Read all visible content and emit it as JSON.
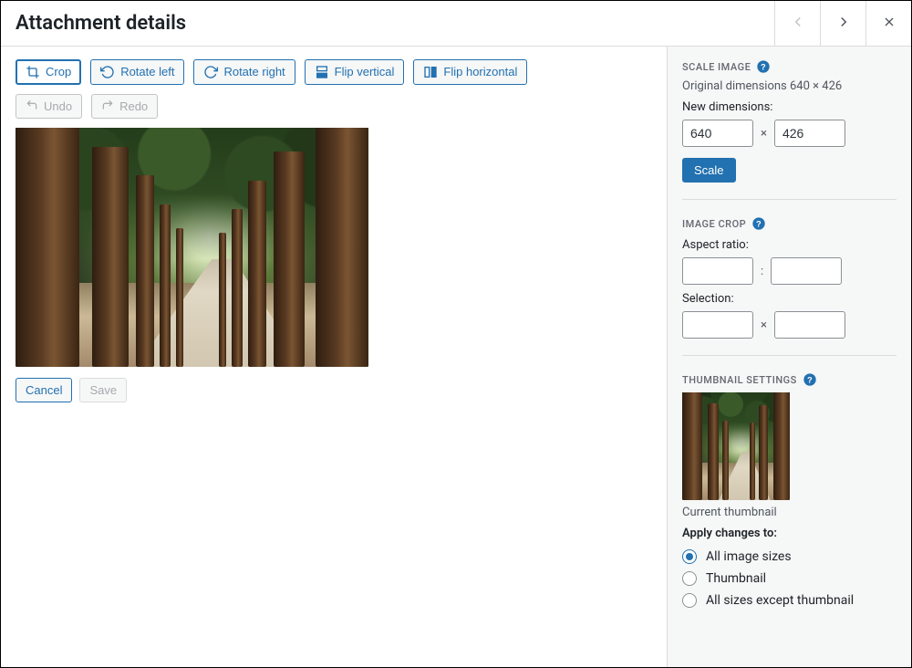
{
  "header": {
    "title": "Attachment details"
  },
  "toolbar": {
    "crop": "Crop",
    "rotate_left": "Rotate left",
    "rotate_right": "Rotate right",
    "flip_vertical": "Flip vertical",
    "flip_horizontal": "Flip horizontal",
    "undo": "Undo",
    "redo": "Redo"
  },
  "actions": {
    "cancel": "Cancel",
    "save": "Save"
  },
  "scale": {
    "title": "SCALE IMAGE",
    "original_label": "Original dimensions 640 × 426",
    "new_dimensions_label": "New dimensions:",
    "width": "640",
    "height": "426",
    "sep": "×",
    "button": "Scale"
  },
  "crop": {
    "title": "IMAGE CROP",
    "aspect_label": "Aspect ratio:",
    "aspect_w": "",
    "aspect_h": "",
    "aspect_sep": ":",
    "selection_label": "Selection:",
    "sel_w": "",
    "sel_h": "",
    "sel_sep": "×"
  },
  "thumb": {
    "title": "THUMBNAIL SETTINGS",
    "caption": "Current thumbnail",
    "apply_label": "Apply changes to:",
    "options": [
      {
        "label": "All image sizes",
        "checked": true
      },
      {
        "label": "Thumbnail",
        "checked": false
      },
      {
        "label": "All sizes except thumbnail",
        "checked": false
      }
    ]
  }
}
